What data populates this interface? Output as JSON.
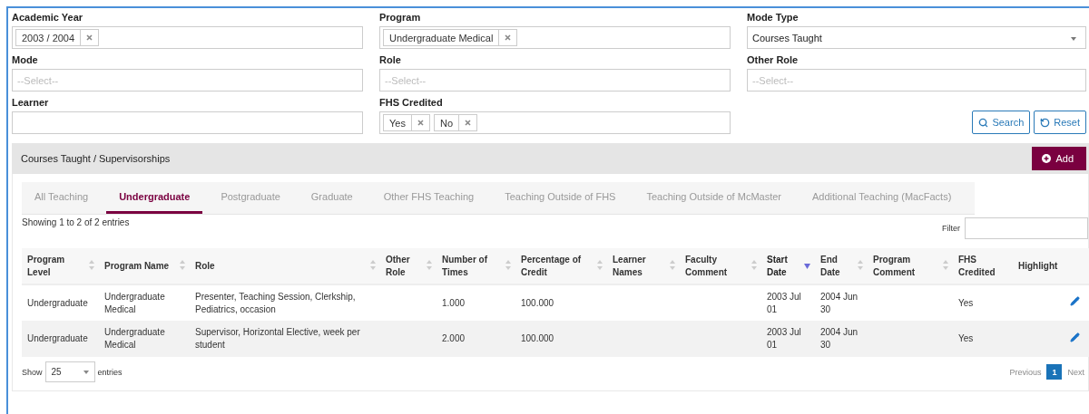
{
  "filters": [
    {
      "label": "Academic Year",
      "kind": "tags",
      "tags": [
        "2003 / 2004"
      ]
    },
    {
      "label": "Program",
      "kind": "tags",
      "tags": [
        "Undergraduate Medical"
      ]
    },
    {
      "label": "Mode Type",
      "kind": "select",
      "value": "Courses Taught"
    },
    {
      "label": "Mode",
      "kind": "picker",
      "placeholder": "--Select--"
    },
    {
      "label": "Role",
      "kind": "picker",
      "placeholder": "--Select--"
    },
    {
      "label": "Other Role",
      "kind": "picker",
      "placeholder": "--Select--"
    },
    {
      "label": "Learner",
      "kind": "text"
    },
    {
      "label": "FHS Credited",
      "kind": "tags",
      "tags": [
        "Yes",
        "No"
      ]
    }
  ],
  "buttons": [
    {
      "label": "Search",
      "kind": "search"
    },
    {
      "label": "Reset",
      "kind": "reset"
    }
  ],
  "section": {
    "title": "Courses Taught / Supervisorships",
    "add_button": "Add"
  },
  "tabs": [
    {
      "label": "All Teaching",
      "selected": false
    },
    {
      "label": "Undergraduate",
      "selected": true
    },
    {
      "label": "Postgraduate",
      "selected": false
    },
    {
      "label": "Graduate",
      "selected": false
    },
    {
      "label": "Other FHS Teaching",
      "selected": false
    },
    {
      "label": "Teaching Outside of FHS",
      "selected": false
    },
    {
      "label": "Teaching Outside of McMaster",
      "selected": false
    },
    {
      "label": "Additional Teaching (MacFacts)",
      "selected": false
    }
  ],
  "info": "Showing 1 to 2 of 2 entries",
  "filter_label": "Filter",
  "table": {
    "columns": [
      {
        "label": "Program Level",
        "sortable": true,
        "sorted": false
      },
      {
        "label": "Program Name",
        "sortable": true,
        "sorted": false
      },
      {
        "label": "Role",
        "sortable": true,
        "sorted": false
      },
      {
        "label": "Other Role",
        "sortable": true,
        "sorted": false
      },
      {
        "label": "Number of Times",
        "sortable": true,
        "sorted": false
      },
      {
        "label": "Percentage of Credit",
        "sortable": true,
        "sorted": false
      },
      {
        "label": "Learner Names",
        "sortable": true,
        "sorted": false
      },
      {
        "label": "Faculty Comment",
        "sortable": true,
        "sorted": false
      },
      {
        "label": "Start Date",
        "sortable": true,
        "sorted": true
      },
      {
        "label": "End Date",
        "sortable": true,
        "sorted": false
      },
      {
        "label": "Program Comment",
        "sortable": true,
        "sorted": false
      },
      {
        "label": "FHS Credited"
      },
      {
        "label": "Highlight"
      }
    ],
    "rows": [
      {
        "cells": [
          "Undergraduate",
          "Undergraduate Medical",
          "Presenter, Teaching Session, Clerkship, Pediatrics, occasion",
          "",
          "1.000",
          "100.000",
          "",
          "",
          "2003 Jul 01",
          "2004 Jun 30",
          "",
          "Yes"
        ]
      },
      {
        "cells": [
          "Undergraduate",
          "Undergraduate Medical",
          "Supervisor, Horizontal Elective, week per student",
          "",
          "2.000",
          "100.000",
          "",
          "",
          "2003 Jul 01",
          "2004 Jun 30",
          "",
          "Yes"
        ]
      }
    ]
  },
  "footer": {
    "show": "Show",
    "page_size": "25",
    "entries": "entries"
  },
  "pagination": {
    "previous": {
      "label": "Previous",
      "disabled": true
    },
    "pages": [
      {
        "label": "1",
        "selected": true
      }
    ],
    "next": {
      "label": "Next",
      "disabled": true
    }
  }
}
